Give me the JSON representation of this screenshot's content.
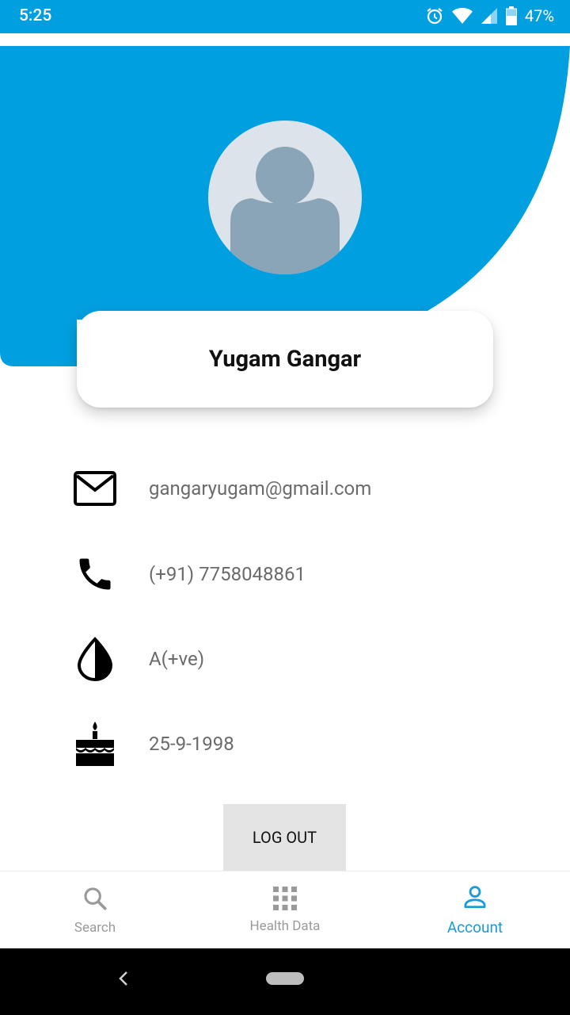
{
  "status_bar": {
    "time": "5:25",
    "battery": "47%"
  },
  "profile": {
    "name": "Yugam Gangar"
  },
  "info": {
    "email": "gangaryugam@gmail.com",
    "phone": "(+91) 7758048861",
    "blood_group": "A(+ve)",
    "birthdate": "25-9-1998"
  },
  "actions": {
    "logout_label": "LOG OUT"
  },
  "bottom_nav": {
    "items": [
      {
        "label": "Search",
        "icon": "search-icon"
      },
      {
        "label": "Health Data",
        "icon": "grid-icon"
      },
      {
        "label": "Account",
        "icon": "person-icon",
        "active": true
      }
    ]
  },
  "colors": {
    "accent": "#009fe0",
    "active_nav": "#1a9ad6",
    "avatar_bg": "#dde3ea",
    "avatar_fg": "#8aa5b8"
  }
}
